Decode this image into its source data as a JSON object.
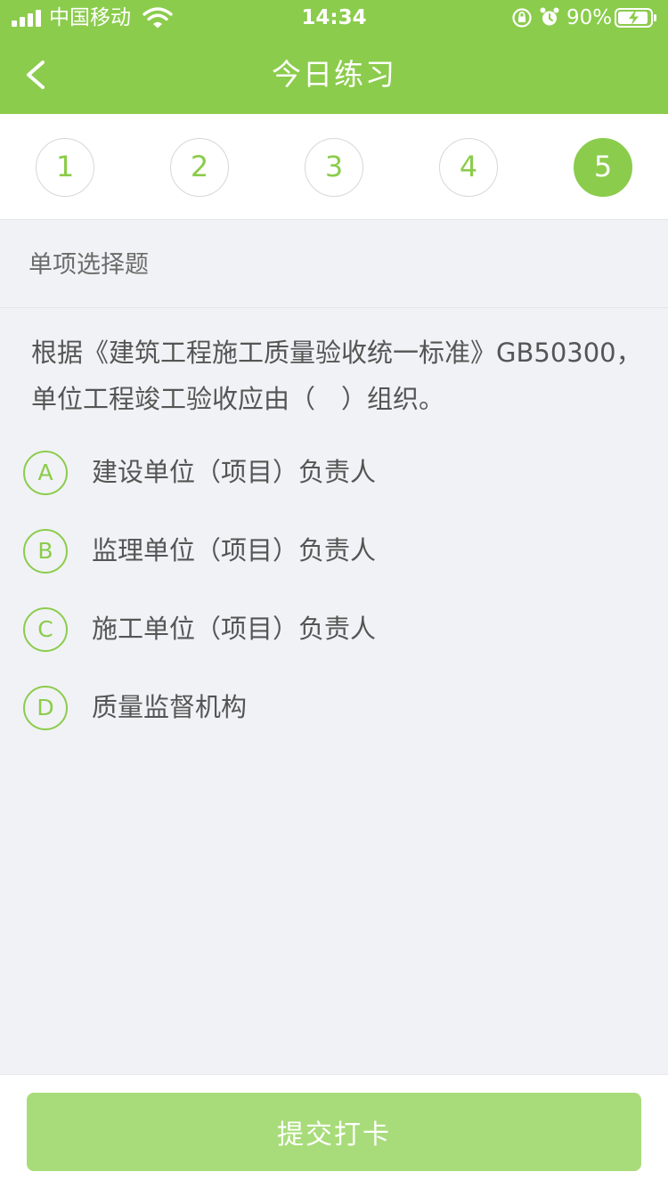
{
  "status_bar": {
    "carrier": "中国移动",
    "time": "14:34",
    "battery_percent": "90%"
  },
  "nav": {
    "title": "今日练习"
  },
  "steps": [
    {
      "label": "1",
      "active": false
    },
    {
      "label": "2",
      "active": false
    },
    {
      "label": "3",
      "active": false
    },
    {
      "label": "4",
      "active": false
    },
    {
      "label": "5",
      "active": true
    }
  ],
  "question": {
    "type": "单项选择题",
    "line1": "根据《建筑工程施工质量验收统一标准》GB50300，",
    "line2": "单位工程竣工验收应由（　）组织。",
    "options": [
      {
        "key": "A",
        "text": "建设单位（项目）负责人"
      },
      {
        "key": "B",
        "text": "监理单位（项目）负责人"
      },
      {
        "key": "C",
        "text": "施工单位（项目）负责人"
      },
      {
        "key": "D",
        "text": "质量监督机构"
      }
    ]
  },
  "footer": {
    "submit_label": "提交打卡"
  },
  "colors": {
    "accent": "#8bcc4c",
    "button_disabled": "#a8dc7a",
    "background": "#f1f2f5"
  }
}
